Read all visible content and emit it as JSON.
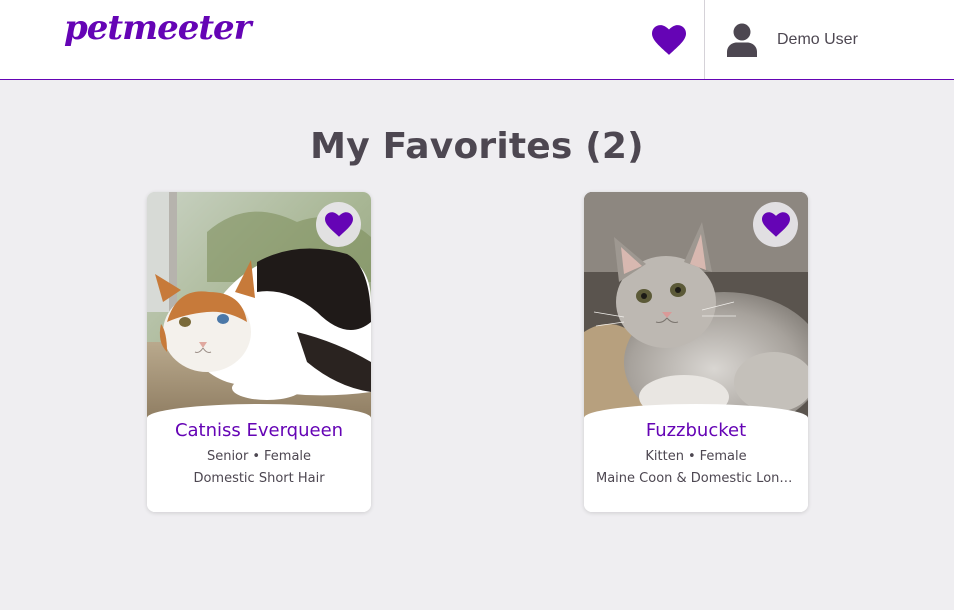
{
  "header": {
    "logo_text": "petmeeter",
    "user_name": "Demo User"
  },
  "page": {
    "title": "My Favorites (2)"
  },
  "pets": [
    {
      "name": "Catniss Everqueen",
      "age": "Senior",
      "separator": "•",
      "gender": "Female",
      "breed": "Domestic Short Hair"
    },
    {
      "name": "Fuzzbucket",
      "age": "Kitten",
      "separator": "•",
      "gender": "Female",
      "breed": "Maine Coon & Domestic Long Hair"
    }
  ],
  "colors": {
    "brand": "#6504b5",
    "background": "#efeef1",
    "text": "#4d4751"
  },
  "icons": {
    "favorites_nav": "heart-icon",
    "user": "user-icon",
    "card_favorite": "heart-icon"
  }
}
